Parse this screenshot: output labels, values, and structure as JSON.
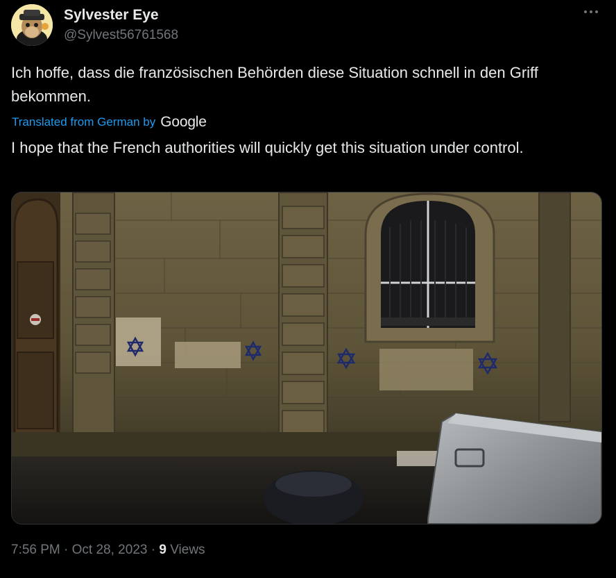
{
  "author": {
    "display_name": "Sylvester Eye",
    "handle": "@Sylvest56761568",
    "avatar_icon": "cartoon-ape-avatar"
  },
  "more_icon": "more-options-icon",
  "tweet": {
    "original_text": "Ich hoffe, dass die französischen Behörden diese Situation schnell in den Griff bekommen.",
    "translated_label": "Translated from German by",
    "translator_brand": "Google",
    "translated_text": "I hope that the French authorities will quickly get this situation under control."
  },
  "media": {
    "alt_subject": "stone building wall with painted stars"
  },
  "footer": {
    "time": "7:56 PM",
    "sep1": "·",
    "date": "Oct 28, 2023",
    "sep2": "·",
    "views_count": "9",
    "views_label": "Views"
  },
  "colors": {
    "background": "#000000",
    "text": "#e7e9ea",
    "secondary": "#71767b",
    "link": "#1d9bf0"
  }
}
